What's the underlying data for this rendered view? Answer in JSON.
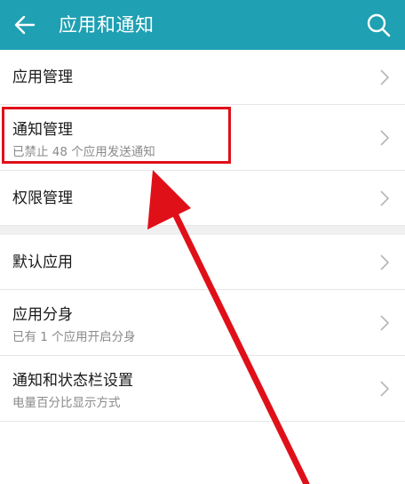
{
  "appbar": {
    "title": "应用和通知",
    "back_icon": "arrow-left-icon",
    "search_icon": "search-icon",
    "color": "#1fa0b3"
  },
  "items": [
    {
      "label": "应用管理"
    },
    {
      "label": "通知管理",
      "sub": "已禁止 48 个应用发送通知"
    },
    {
      "label": "权限管理"
    },
    {
      "label": "默认应用"
    },
    {
      "label": "应用分身",
      "sub": "已有 1 个应用开启分身"
    },
    {
      "label": "通知和状态栏设置",
      "sub": "电量百分比显示方式"
    }
  ],
  "annotation": {
    "color": "#e01019"
  }
}
